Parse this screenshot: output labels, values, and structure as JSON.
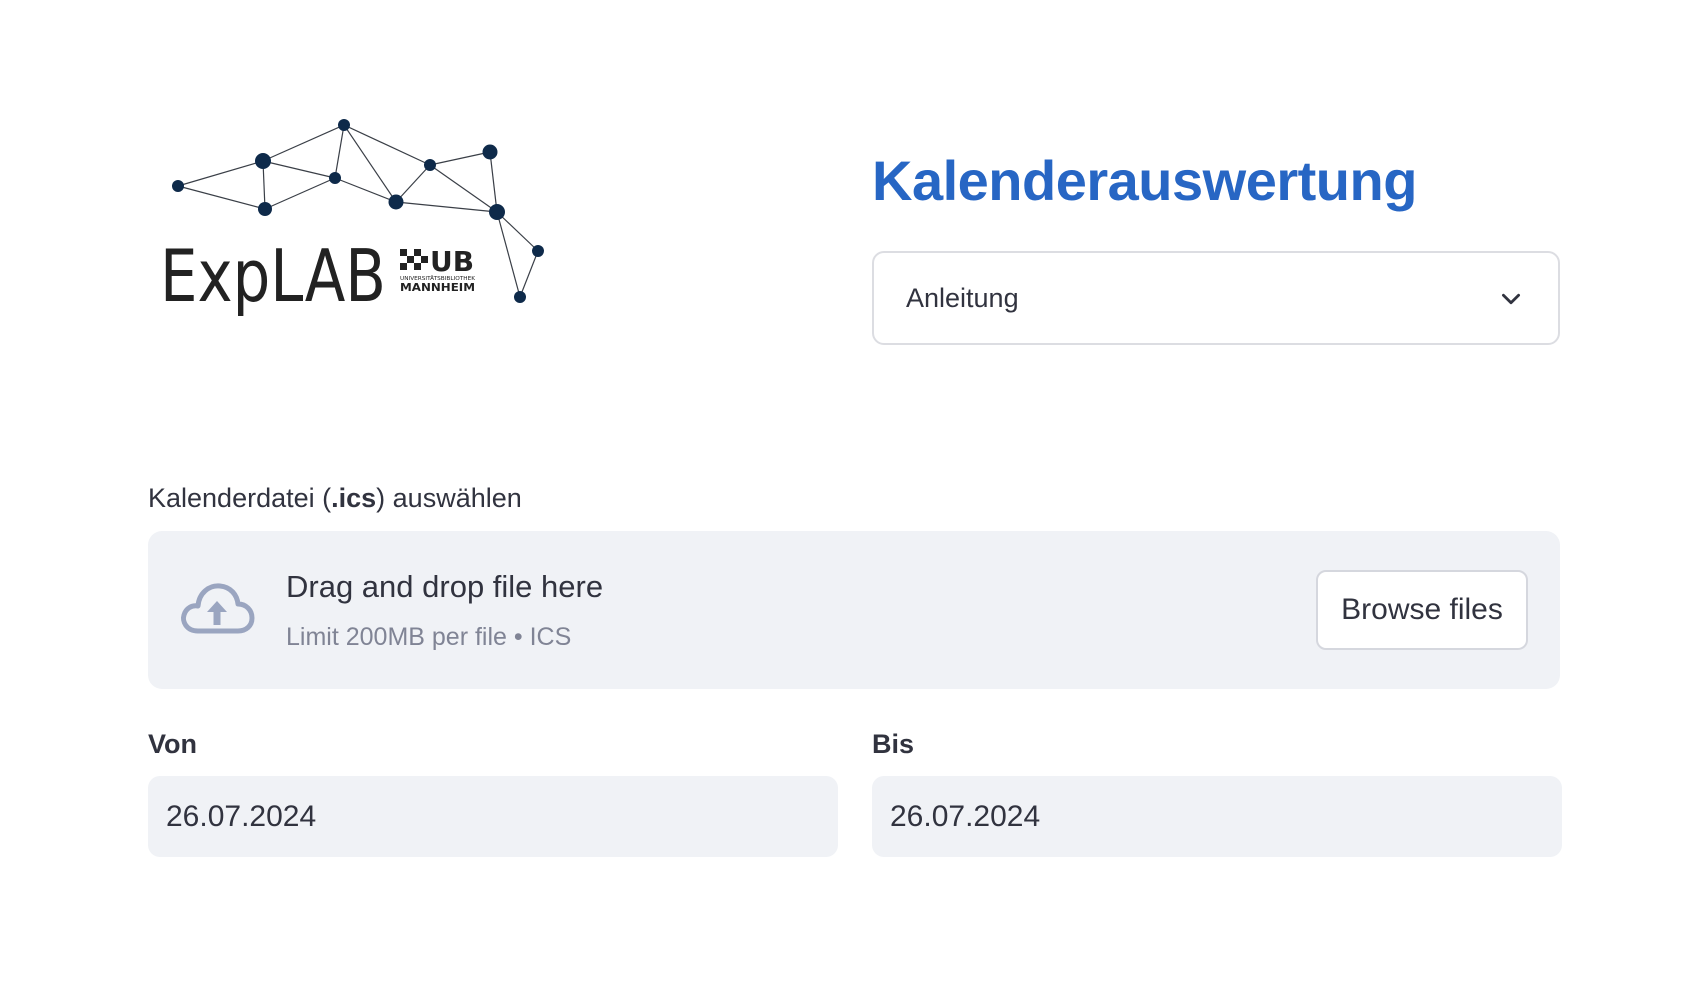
{
  "logo": {
    "wordmark": "ExpLAB",
    "ub_mark": "UB",
    "ub_subline": "UNIVERSITÄTSBIBLIOTHEK",
    "ub_city": "MANNHEIM",
    "color": "#0e2a4a"
  },
  "header": {
    "title": "Kalenderauswertung",
    "title_color": "#2766c4"
  },
  "expander": {
    "label": "Anleitung",
    "icon": "chevron-down-icon"
  },
  "uploader": {
    "label_prefix": "Kalenderdatei (",
    "label_bold": ".ics",
    "label_suffix": ") auswählen",
    "dropzone_title": "Drag and drop file here",
    "dropzone_subtitle": "Limit 200MB per file • ICS",
    "browse_label": "Browse files",
    "icon": "cloud-upload-icon"
  },
  "date_range": {
    "from_label": "Von",
    "from_value": "26.07.2024",
    "to_label": "Bis",
    "to_value": "26.07.2024"
  }
}
